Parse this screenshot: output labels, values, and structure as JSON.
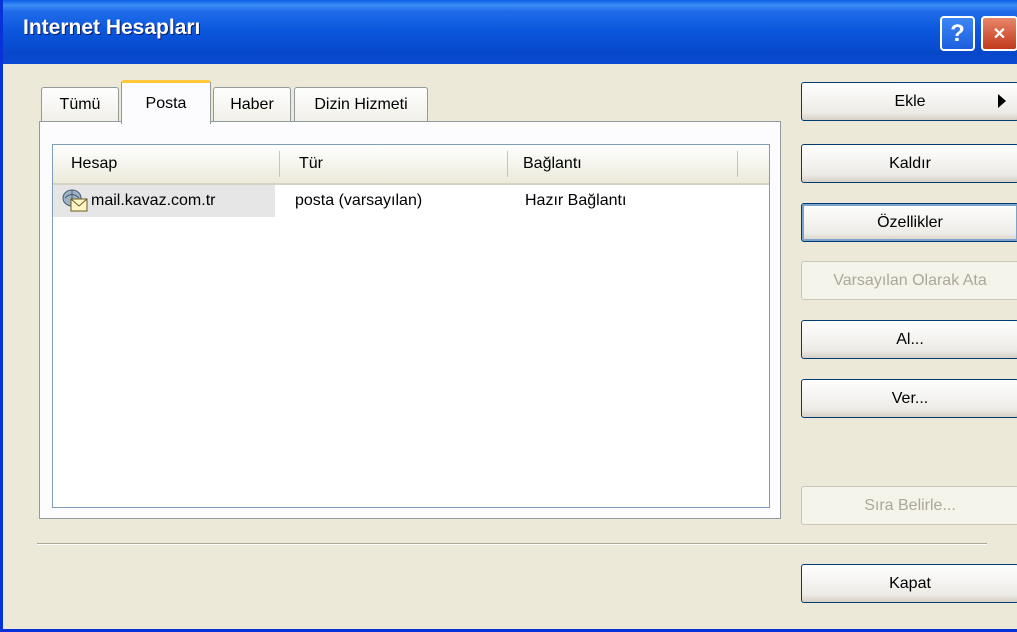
{
  "window": {
    "title": "Internet Hesapları",
    "help_label": "?",
    "close_label": "✕"
  },
  "tabs": [
    {
      "label": "Tümü"
    },
    {
      "label": "Posta"
    },
    {
      "label": "Haber"
    },
    {
      "label": "Dizin Hizmeti"
    }
  ],
  "list": {
    "columns": [
      "Hesap",
      "Tür",
      "Bağlantı"
    ],
    "rows": [
      {
        "account": "mail.kavaz.com.tr",
        "type": "posta (varsayılan)",
        "connection": "Hazır Bağlantı",
        "icon": "mail-account-icon"
      }
    ]
  },
  "buttons": {
    "add": "Ekle",
    "remove": "Kaldır",
    "properties": "Özellikler",
    "set_default": "Varsayılan Olarak Ata",
    "import": "Al...",
    "export": "Ver...",
    "set_order": "Sıra Belirle...",
    "close": "Kapat"
  }
}
